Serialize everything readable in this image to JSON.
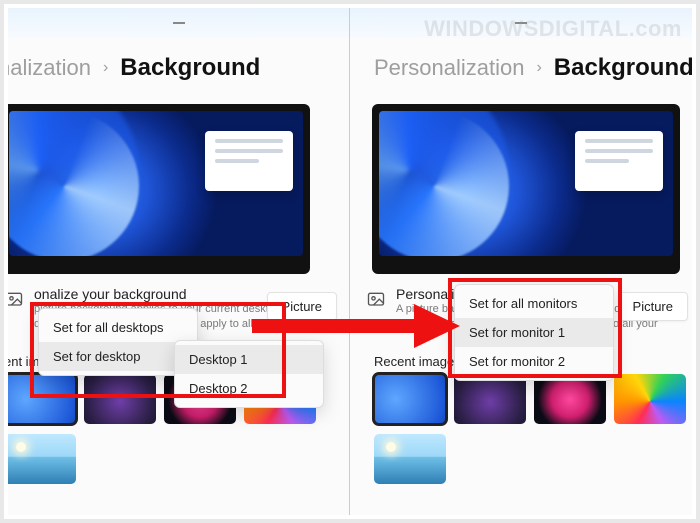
{
  "watermark": "WINDOWSDIGITAL.com",
  "left": {
    "breadcrumb_parent": "nalization",
    "breadcrumb_sep": "›",
    "breadcrumb_current": "Background",
    "section_title": "onalize your background",
    "section_desc1": "picture background applies to your current desktop.",
    "section_desc2": "d color or slideshow backgrounds apply to all your",
    "picture_pill": "Picture",
    "recent_label": "ent images",
    "menu_all": "Set for all desktops",
    "menu_for": "Set for desktop",
    "submenu_1": "Desktop 1",
    "submenu_2": "Desktop 2"
  },
  "right": {
    "breadcrumb_parent": "Personalization",
    "breadcrumb_sep": "›",
    "breadcrumb_current": "Background",
    "section_title": "Personalize your background",
    "section_desc1": "A picture background applies to your current desktop.",
    "section_desc2": "Solid color or slideshow backgrounds apply to all your",
    "picture_pill": "Picture",
    "recent_label": "Recent images",
    "menu_all": "Set for all monitors",
    "menu_m1": "Set for monitor 1",
    "menu_m2": "Set for monitor 2"
  }
}
